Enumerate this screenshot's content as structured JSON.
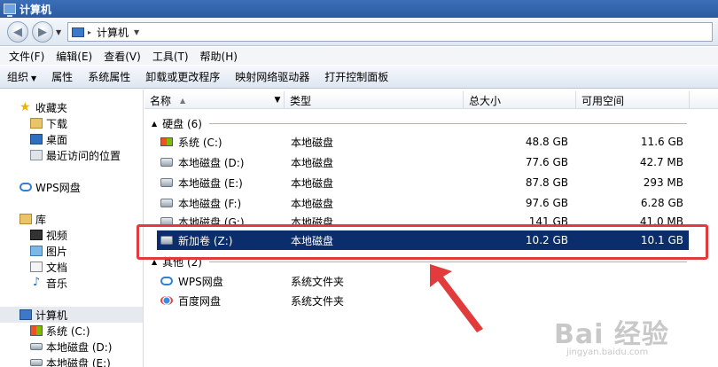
{
  "window": {
    "title": "计算机"
  },
  "address": {
    "path": "计算机"
  },
  "menu": [
    "文件(F)",
    "编辑(E)",
    "查看(V)",
    "工具(T)",
    "帮助(H)"
  ],
  "toolbar": {
    "organize": "组织",
    "commands": [
      "属性",
      "系统属性",
      "卸载或更改程序",
      "映射网络驱动器",
      "打开控制面板"
    ]
  },
  "nav": {
    "favorites": "收藏夹",
    "fav_items": [
      "下载",
      "桌面",
      "最近访问的位置"
    ],
    "wps": "WPS网盘",
    "libraries": "库",
    "lib_items": [
      "视频",
      "图片",
      "文档",
      "音乐"
    ],
    "computer": "计算机",
    "comp_items": [
      "系统 (C:)",
      "本地磁盘 (D:)",
      "本地磁盘 (E:)"
    ]
  },
  "columns": {
    "name": "名称",
    "type": "类型",
    "total": "总大小",
    "free": "可用空间"
  },
  "groups": {
    "hdd": "硬盘 (6)",
    "other": "其他 (2)"
  },
  "drives": [
    {
      "name": "系统 (C:)",
      "type": "本地磁盘",
      "total": "48.8 GB",
      "free": "11.6 GB",
      "icon": "system-drive-icon"
    },
    {
      "name": "本地磁盘 (D:)",
      "type": "本地磁盘",
      "total": "77.6 GB",
      "free": "42.7 MB",
      "icon": "hard-drive-icon"
    },
    {
      "name": "本地磁盘 (E:)",
      "type": "本地磁盘",
      "total": "87.8 GB",
      "free": "293 MB",
      "icon": "hard-drive-icon"
    },
    {
      "name": "本地磁盘 (F:)",
      "type": "本地磁盘",
      "total": "97.6 GB",
      "free": "6.28 GB",
      "icon": "hard-drive-icon"
    },
    {
      "name": "本地磁盘 (G:)",
      "type": "本地磁盘",
      "total": "141 GB",
      "free": "41.0 MB",
      "icon": "hard-drive-icon"
    },
    {
      "name": "新加卷 (Z:)",
      "type": "本地磁盘",
      "total": "10.2 GB",
      "free": "10.1 GB",
      "icon": "hard-drive-icon",
      "selected": true
    }
  ],
  "others": [
    {
      "name": "WPS网盘",
      "type": "系统文件夹",
      "icon": "cloud-icon"
    },
    {
      "name": "百度网盘",
      "type": "系统文件夹",
      "icon": "baidu-netdisk-icon"
    }
  ],
  "watermark": {
    "brand": "Bai 经验",
    "url": "jingyan.baidu.com"
  },
  "colors": {
    "selection": "#0c2d6b",
    "highlight": "#e23b3b",
    "titlebar": "#2a5aa0"
  }
}
